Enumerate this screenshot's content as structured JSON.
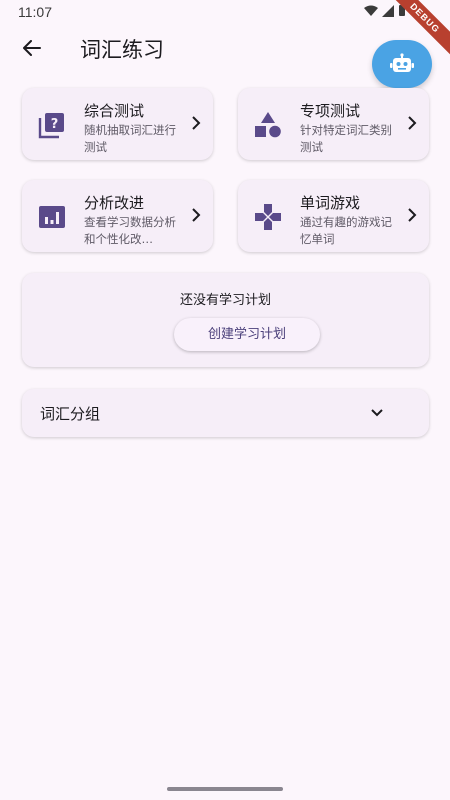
{
  "status_bar": {
    "time": "11:07",
    "debug_label": "DEBUG"
  },
  "app_bar": {
    "title": "词汇练习"
  },
  "features": {
    "comprehensive": {
      "title": "综合测试",
      "desc": "随机抽取词汇进行测试",
      "icon": "quiz-icon"
    },
    "special": {
      "title": "专项测试",
      "desc": "针对特定词汇类别测试",
      "icon": "category-icon"
    },
    "analysis": {
      "title": "分析改进",
      "desc": "查看学习数据分析和个性化改…",
      "icon": "analytics-icon"
    },
    "game": {
      "title": "单词游戏",
      "desc": "通过有趣的游戏记忆单词",
      "icon": "gamepad-icon"
    }
  },
  "plan": {
    "empty_text": "还没有学习计划",
    "create_button": "创建学习计划"
  },
  "groups": {
    "label": "词汇分组"
  },
  "colors": {
    "accent": "#5a4a8a",
    "fab": "#4aa3e4",
    "background": "#fcf6fc",
    "card": "#f6eef8"
  }
}
